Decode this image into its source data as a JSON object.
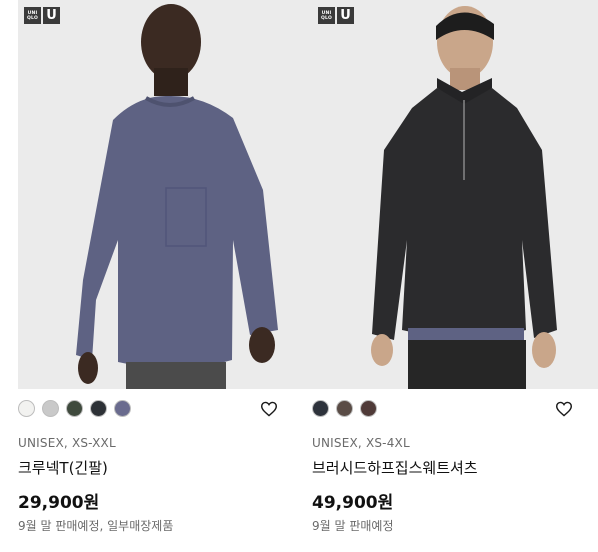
{
  "products": [
    {
      "logo": {
        "box1": [
          "UNI",
          "QLO"
        ],
        "box2": "U"
      },
      "swatches": [
        "#f2f2f0",
        "#c9c9c9",
        "#3f4a3d",
        "#2d3136",
        "#6a6b8e"
      ],
      "meta": "UNISEX, XS-XXL",
      "name": "크루넥T(긴팔)",
      "price": "29,900원",
      "note": "9월 말 판매예정, 일부매장제품",
      "icons": {
        "wishlist": "heart-outline-icon"
      }
    },
    {
      "logo": {
        "box1": [
          "UNI",
          "QLO"
        ],
        "box2": "U"
      },
      "swatches": [
        "#2d323b",
        "#5a4c46",
        "#4f3a38"
      ],
      "meta": "UNISEX, XS-4XL",
      "name": "브러시드하프집스웨트셔츠",
      "price": "49,900원",
      "note": "9월 말 판매예정",
      "icons": {
        "wishlist": "heart-outline-icon"
      }
    }
  ],
  "colors": {
    "background": "#ffffff",
    "photo_bg": "#ebebeb",
    "text": "#1b1b1b",
    "muted": "#6a6a6a"
  }
}
